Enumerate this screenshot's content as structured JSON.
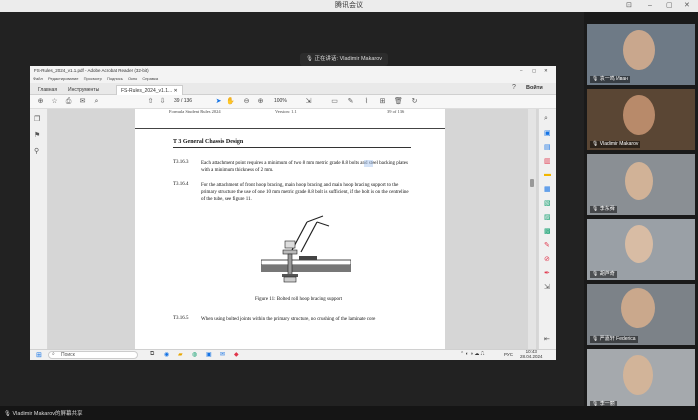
{
  "meeting": {
    "window_title": "腾讯会议",
    "speaking_label": "正在讲话:",
    "speaker_name": "Vladimir Makarov",
    "sharing_status": "Vladimir Makarov的屏幕共享"
  },
  "acrobat": {
    "title": "FS-Rules_2024_v1.1.pdf - Adobe Acrobat Reader (32-bit)",
    "menu": [
      "Файл",
      "Редактирование",
      "Просмотр",
      "Подпись",
      "Окно",
      "Справка"
    ],
    "tabs": {
      "home": "Главная",
      "tools": "Инструменты",
      "file": "FS-Rules_2024_v1.1..."
    },
    "signin": "Войти",
    "page_current": "39",
    "page_sep": "/",
    "page_total": "136",
    "zoom": "100%"
  },
  "pdf": {
    "header_left": "Formula Student Rules 2024",
    "header_mid": "Version: 1.1",
    "header_right": "39 of 136",
    "section_title": "T 3  General Chassis Design",
    "rules": [
      {
        "id": "T3.16.3",
        "text": "Each attachment point requires a minimum of two 8 mm metric grade 8.8 bolts and steel backing plates with a minimum thickness of 2 mm."
      },
      {
        "id": "T3.16.4",
        "text": "For the attachment of front hoop bracing, main hoop bracing and main hoop bracing support to the primary structure the use of one 10 mm metric grade 8.8 bolt is sufficient, if the bolt is on the centreline of the tube, see figure 11."
      },
      {
        "id": "T3.16.5",
        "text": "When using bolted joints within the primary structure, no crushing of the laminate core"
      }
    ],
    "highlight": "8.8",
    "figure_caption": "Figure 11: Bolted roll hoop bracing support"
  },
  "taskbar": {
    "search": "Поиск",
    "lang": "РУС",
    "time": "10:43",
    "date": "28.04.2024"
  },
  "participants": [
    {
      "name": "袁一鸣 Иван",
      "skin": "#c9a78d",
      "bg": "#6e7a86"
    },
    {
      "name": "Vladimir Makarov",
      "skin": "#b88a6a",
      "bg": "#5a4634"
    },
    {
      "name": "李东舜",
      "skin": "#d1b297",
      "bg": "#8a8f94"
    },
    {
      "name": "胡芦奇",
      "skin": "#d8bca4",
      "bg": "#9aa0a6"
    },
    {
      "name": "严嘉轩 Federica",
      "skin": "#caa88c",
      "bg": "#7c8288"
    },
    {
      "name": "李一丽",
      "skin": "#d2b499",
      "bg": "#a5a9ad"
    }
  ],
  "colors": {
    "highlight": "#a9c8f2",
    "accent": "#1473e6"
  }
}
